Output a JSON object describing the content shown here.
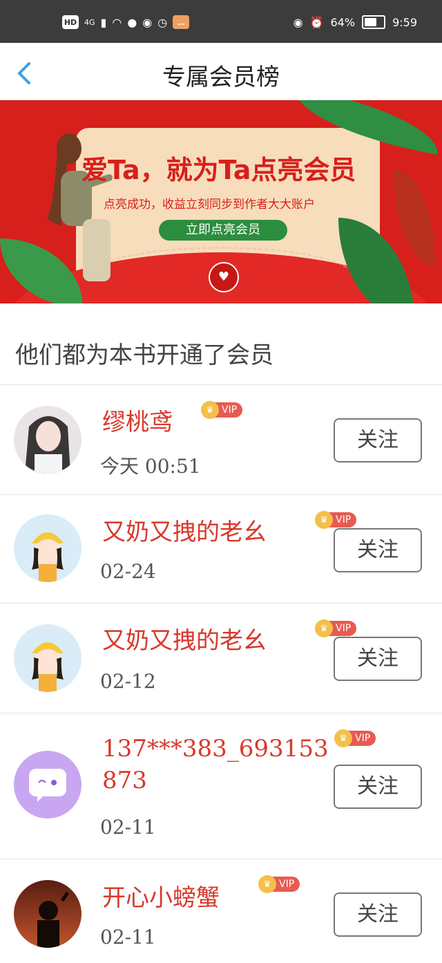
{
  "status_bar": {
    "left_icons": [
      "HD",
      "4G",
      "signal-icon",
      "wifi-icon",
      "wechat-icon",
      "app-icon",
      "clock-app-icon",
      "message-app-icon"
    ],
    "eye_icon": "eye-icon",
    "alarm_icon": "alarm-icon",
    "battery_percent": "64%",
    "battery_level": 0.64,
    "time": "9:59"
  },
  "header": {
    "title": "专属会员榜",
    "back_icon": "chevron-left-icon"
  },
  "banner": {
    "headline": "爱Ta，就为Ta点亮会员",
    "subtext": "点亮成功，收益立刻同步到作者大大账户",
    "cta": "立即点亮会员"
  },
  "section_title": "他们都为本书开通了会员",
  "members": [
    {
      "name": "缪桃鸢",
      "date": "今天 00:51",
      "badge": "VIP",
      "follow": "关注"
    },
    {
      "name": "又奶又拽的老幺",
      "date": "02-24",
      "badge": "VIP",
      "follow": "关注"
    },
    {
      "name": "又奶又拽的老幺",
      "date": "02-12",
      "badge": "VIP",
      "follow": "关注"
    },
    {
      "name": "137***383_693153873",
      "date": "02-11",
      "badge": "VIP",
      "follow": "关注"
    },
    {
      "name": "开心小螃蟹",
      "date": "02-11",
      "badge": "VIP",
      "follow": "关注"
    }
  ],
  "colors": {
    "accent_red": "#d8392b",
    "banner_red": "#d71f1c",
    "link_blue": "#3aa0e8"
  }
}
